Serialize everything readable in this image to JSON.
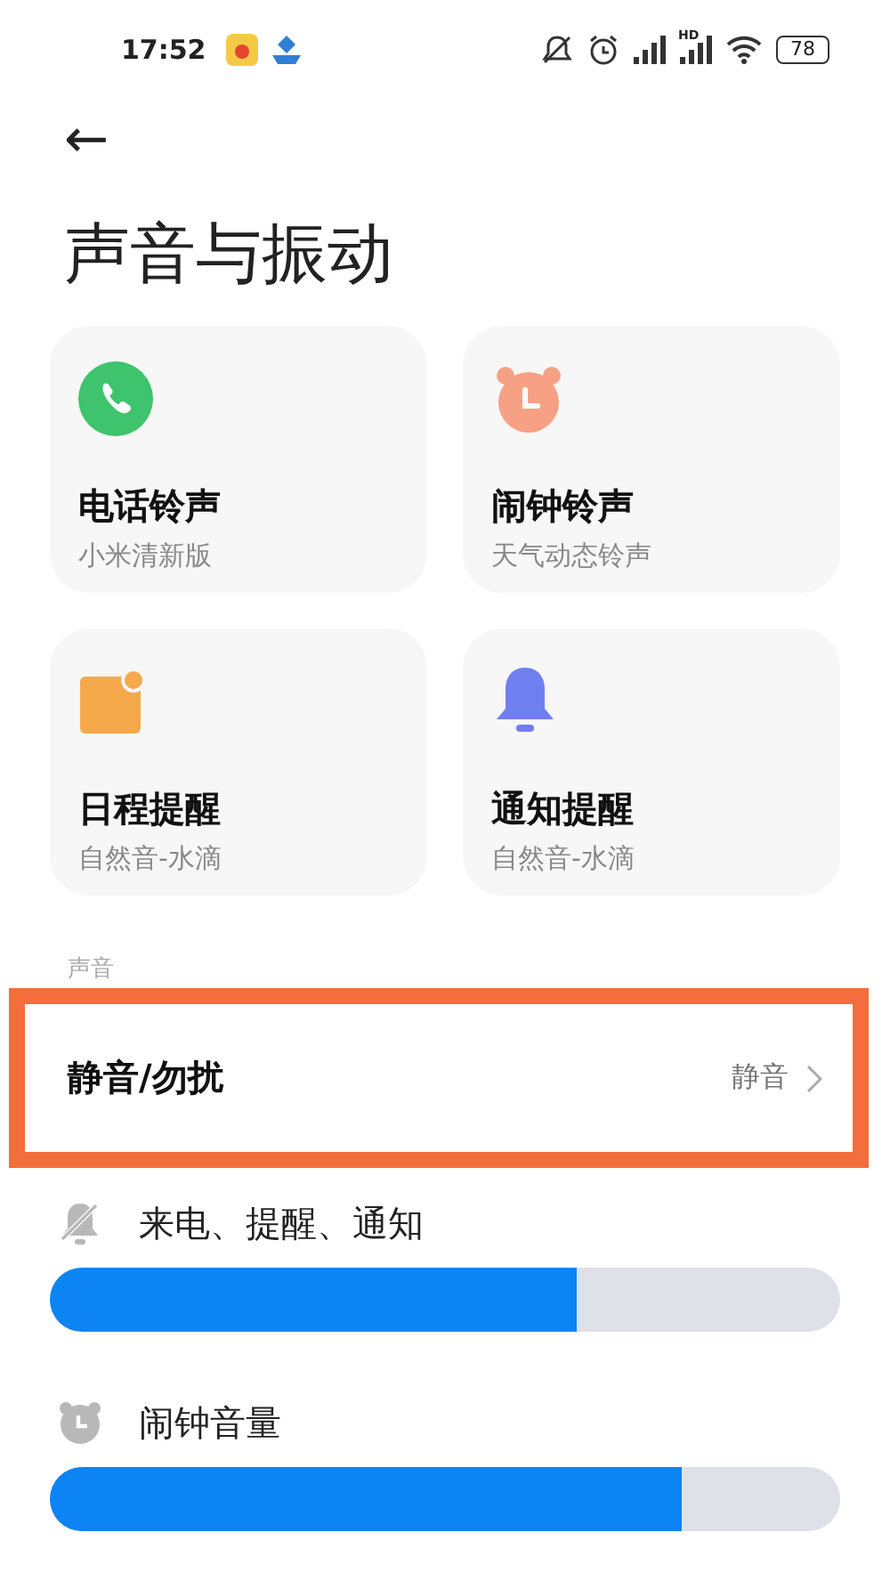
{
  "status_bar": {
    "time": "17:52",
    "network_badge": "HD",
    "battery": "78"
  },
  "header": {
    "back": "←",
    "title": "声音与振动"
  },
  "cards": [
    {
      "kind": "phone",
      "title": "电话铃声",
      "subtitle": "小米清新版"
    },
    {
      "kind": "alarm",
      "title": "闹钟铃声",
      "subtitle": "天气动态铃声"
    },
    {
      "kind": "calendar",
      "title": "日程提醒",
      "subtitle": "自然音-水滴"
    },
    {
      "kind": "bell",
      "title": "通知提醒",
      "subtitle": "自然音-水滴"
    }
  ],
  "section_label": "声音",
  "dnd_row": {
    "label": "静音/勿扰",
    "value": "静音",
    "highlighted": true
  },
  "volumes": [
    {
      "kind": "muted-bell",
      "label": "来电、提醒、通知",
      "level": 0.667
    },
    {
      "kind": "alarm",
      "label": "闹钟音量",
      "level": 0.8
    }
  ]
}
